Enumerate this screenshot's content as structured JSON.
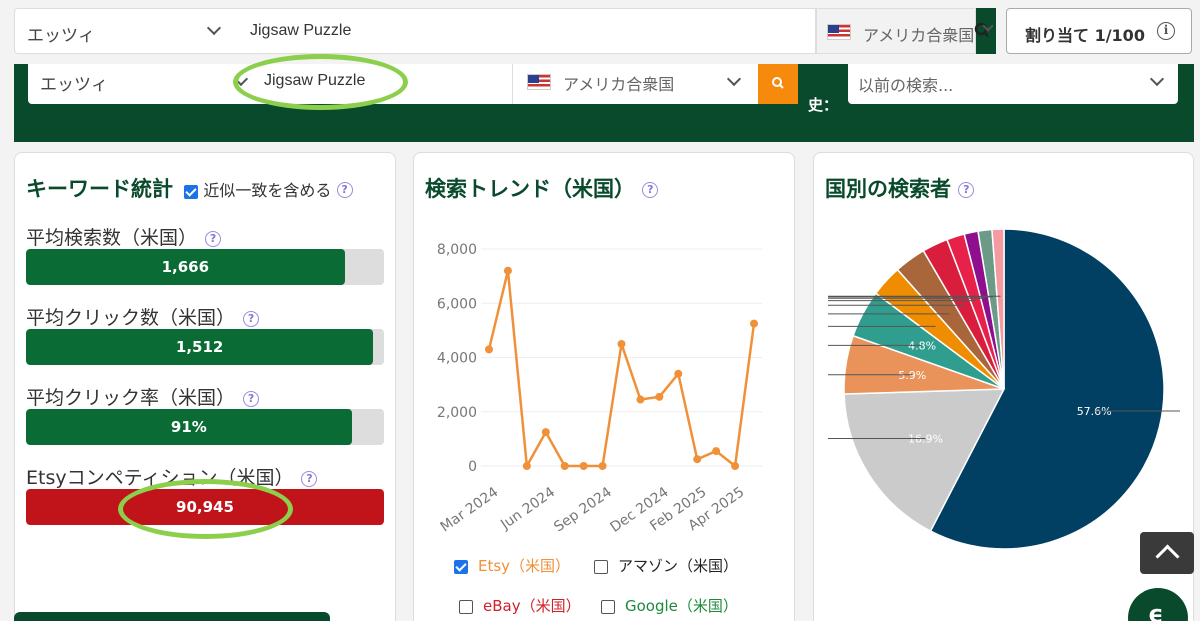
{
  "topbar": {
    "marketplace": "エッツィ",
    "keyword": "Jigsaw Puzzle",
    "country": "アメリカ合衆国",
    "assign_label": "割り当て 1/100"
  },
  "banner": {
    "marketplace": "エッツィ",
    "keyword": "Jigsaw Puzzle",
    "country": "アメリカ合衆国",
    "history_label": "史：",
    "history_placeholder": "以前の検索..."
  },
  "stats": {
    "title": "キーワード統計",
    "approx_label": "近似一致を含める",
    "items": [
      {
        "label": "平均検索数（米国）",
        "value": "1,666",
        "fill": 0.89,
        "color": "#0a6b34"
      },
      {
        "label": "平均クリック数（米国）",
        "value": "1,512",
        "fill": 0.97,
        "color": "#0a6b34"
      },
      {
        "label": "平均クリック率（米国）",
        "value": "91%",
        "fill": 0.91,
        "color": "#0a6b34"
      },
      {
        "label": "Etsyコンペティション（米国）",
        "value": "90,945",
        "fill": 1.0,
        "color": "#c0141a"
      }
    ]
  },
  "trend": {
    "title": "検索トレンド（米国）",
    "legend": [
      {
        "label": "Etsy（米国）",
        "checked": true,
        "color": "#f0913a"
      },
      {
        "label": "アマゾン（米国）",
        "checked": false,
        "color": "#222222"
      },
      {
        "label": "eBay（米国）",
        "checked": false,
        "color": "#d0202a"
      },
      {
        "label": "Google（米国）",
        "checked": false,
        "color": "#1d8a3a"
      }
    ]
  },
  "countries": {
    "title": "国別の検索者"
  },
  "chart_data": [
    {
      "type": "line",
      "x_tick_labels": [
        "Mar 2024",
        "Jun 2024",
        "Sep 2024",
        "Dec 2024",
        "Feb 2025",
        "Apr 2025"
      ],
      "x_tick_index": [
        0,
        3,
        6,
        9,
        11,
        13
      ],
      "y_ticks": [
        0,
        2000,
        4000,
        6000,
        8000
      ],
      "y_tick_labels": [
        "0",
        "2,000",
        "4,000",
        "6,000",
        "8,000"
      ],
      "ylim": [
        0,
        8000
      ],
      "series": [
        {
          "name": "Etsy（米国）",
          "color": "#f0913a",
          "values": [
            4300,
            7200,
            0,
            1250,
            0,
            0,
            0,
            4500,
            2450,
            2550,
            3400,
            250,
            550,
            0,
            5250
          ]
        }
      ],
      "grid": true
    },
    {
      "type": "pie",
      "slices": [
        {
          "value": 57.6,
          "label": "57.6%",
          "color": "#013f63"
        },
        {
          "value": 16.9,
          "label": "16.9%",
          "color": "#cbcbcb"
        },
        {
          "value": 5.9,
          "label": "5.9%",
          "color": "#e9935a"
        },
        {
          "value": 4.8,
          "label": "4.8%",
          "color": "#2f9e8f"
        },
        {
          "value": 3.2,
          "label": "",
          "color": "#f08c00"
        },
        {
          "value": 3.2,
          "label": "",
          "color": "#a9663a"
        },
        {
          "value": 2.6,
          "label": "",
          "color": "#d81e3c"
        },
        {
          "value": 1.8,
          "label": "",
          "color": "#e8214a"
        },
        {
          "value": 1.4,
          "label": "",
          "color": "#8e0f8e"
        },
        {
          "value": 1.4,
          "label": "",
          "color": "#6b9a86"
        },
        {
          "value": 1.2,
          "label": "",
          "color": "#f49aa0"
        }
      ]
    }
  ]
}
